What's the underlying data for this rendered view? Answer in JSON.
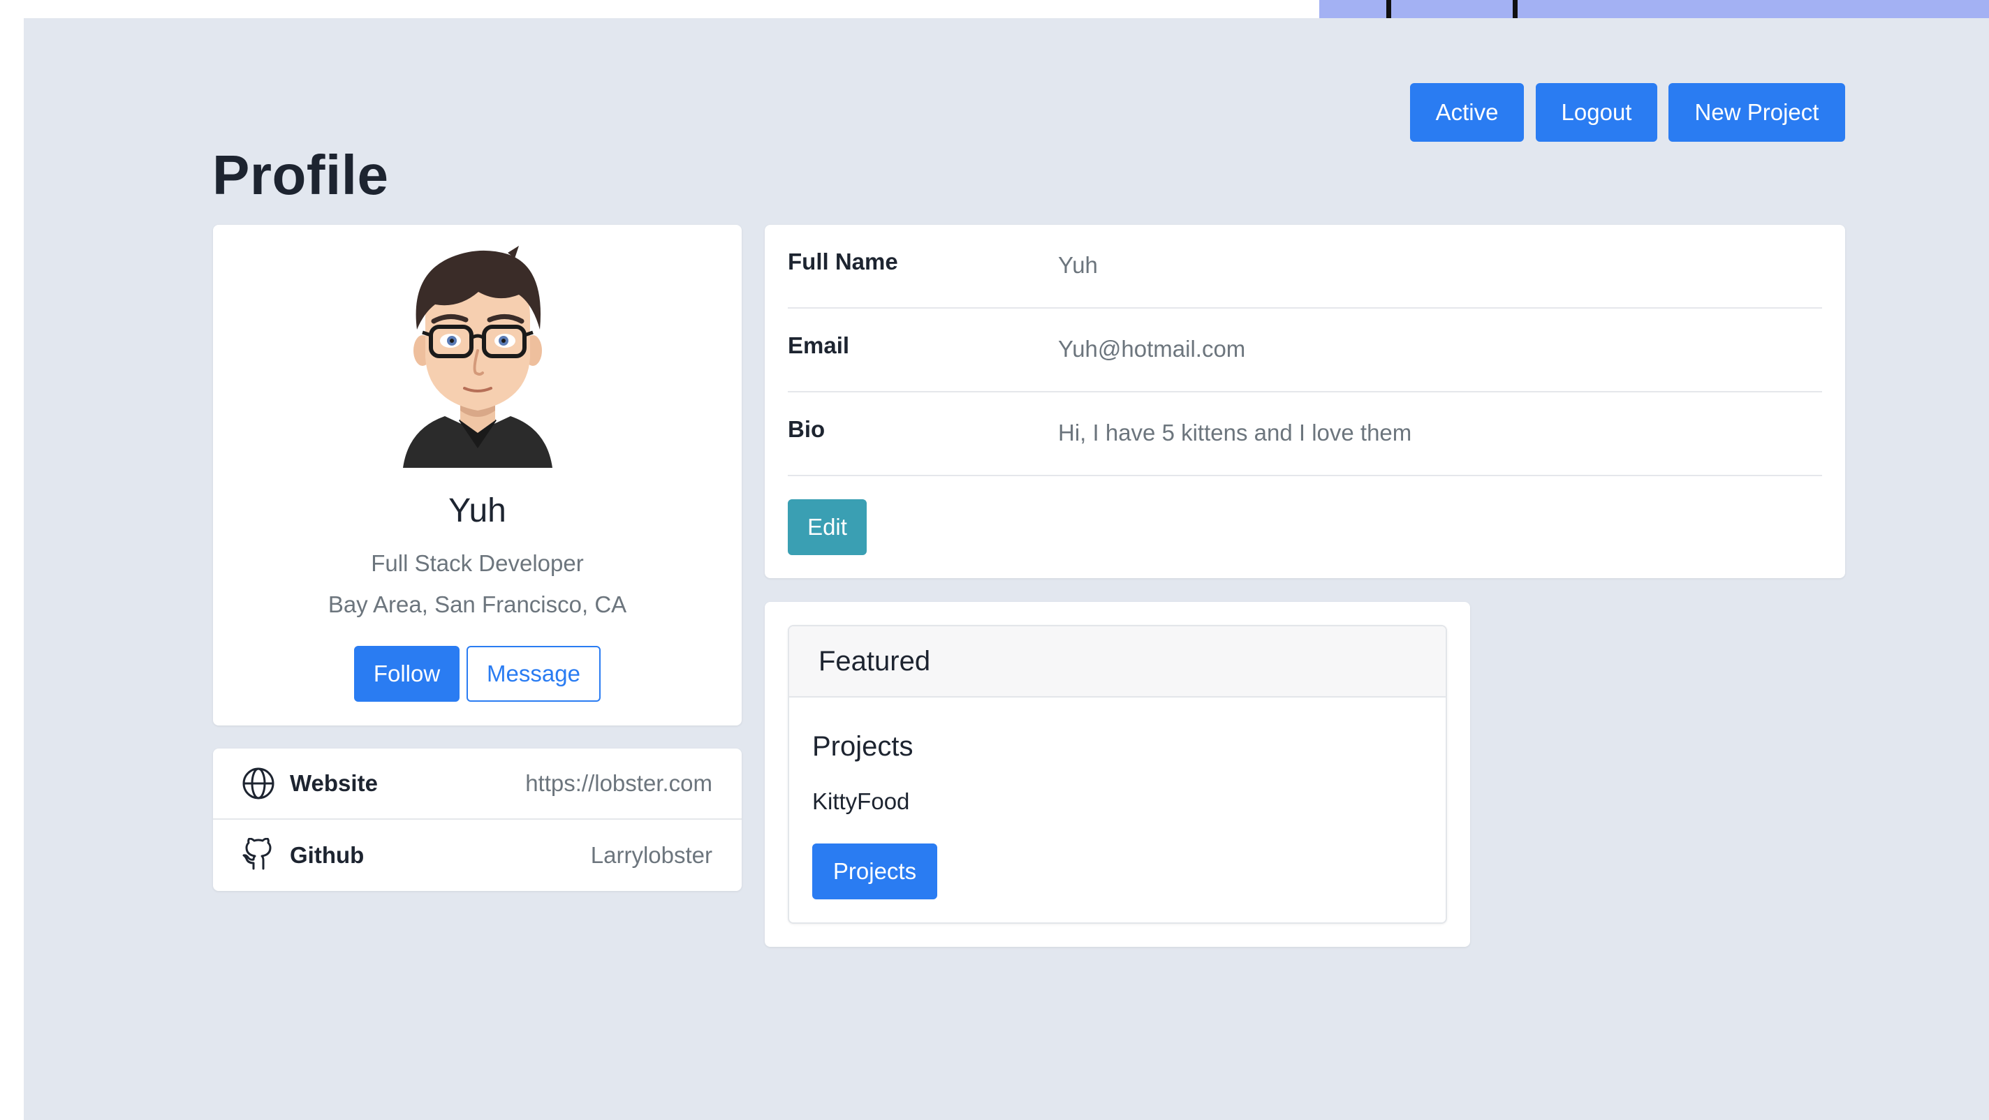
{
  "header": {
    "buttons": {
      "active": "Active",
      "logout": "Logout",
      "new_project": "New Project"
    }
  },
  "page": {
    "title": "Profile"
  },
  "profile": {
    "name": "Yuh",
    "role": "Full Stack Developer",
    "location": "Bay Area, San Francisco, CA",
    "follow_label": "Follow",
    "message_label": "Message",
    "avatar_icon": "cartoon-avatar"
  },
  "links": [
    {
      "icon": "globe-icon",
      "label": "Website",
      "value": "https://lobster.com"
    },
    {
      "icon": "github-icon",
      "label": "Github",
      "value": "Larrylobster"
    }
  ],
  "details": {
    "rows": [
      {
        "label": "Full Name",
        "value": "Yuh"
      },
      {
        "label": "Email",
        "value": "Yuh@hotmail.com"
      },
      {
        "label": "Bio",
        "value": "Hi, I have 5 kittens and I love them"
      }
    ],
    "edit_label": "Edit"
  },
  "featured": {
    "title": "Featured",
    "section_title": "Projects",
    "item": "KittyFood",
    "button_label": "Projects"
  },
  "colors": {
    "primary": "#2a7cf2",
    "info": "#3a9fb3",
    "page_background": "#e2e7ef",
    "top_accent": "#a3b1f3"
  }
}
